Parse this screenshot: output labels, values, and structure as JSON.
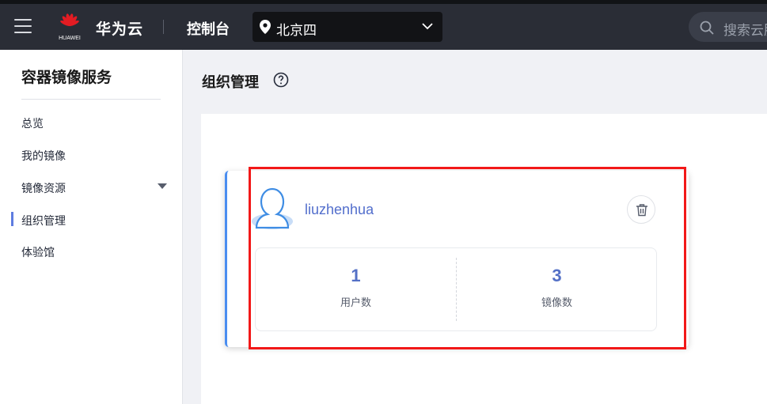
{
  "header": {
    "brand": "华为云",
    "logo_text": "HUAWEI",
    "console_label": "控制台",
    "region": "北京四",
    "search_placeholder": "搜索云服"
  },
  "sidebar": {
    "title": "容器镜像服务",
    "items": [
      {
        "label": "总览"
      },
      {
        "label": "我的镜像"
      },
      {
        "label": "镜像资源"
      },
      {
        "label": "组织管理"
      },
      {
        "label": "体验馆"
      }
    ],
    "active_item": "组织管理"
  },
  "main": {
    "page_title": "组织管理",
    "org_card": {
      "name": "liuzhenhua",
      "stats": [
        {
          "value": "1",
          "label": "用户数"
        },
        {
          "value": "3",
          "label": "镜像数"
        }
      ]
    }
  },
  "colors": {
    "topbar": "#2a2d36",
    "accent": "#5e7ce0",
    "link": "#526ecc",
    "highlight": "#f21818"
  }
}
